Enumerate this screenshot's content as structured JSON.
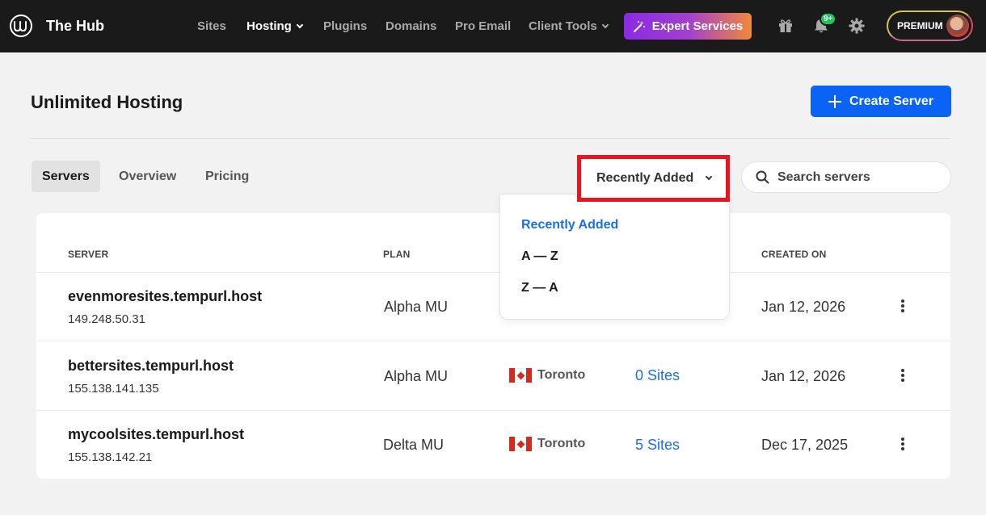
{
  "app": {
    "name": "The Hub"
  },
  "nav": {
    "items": [
      {
        "label": "Sites",
        "active": false,
        "has_menu": false
      },
      {
        "label": "Hosting",
        "active": true,
        "has_menu": true
      },
      {
        "label": "Plugins",
        "active": false,
        "has_menu": false
      },
      {
        "label": "Domains",
        "active": false,
        "has_menu": false
      },
      {
        "label": "Pro Email",
        "active": false,
        "has_menu": false
      },
      {
        "label": "Client Tools",
        "active": false,
        "has_menu": true
      }
    ],
    "expert_label": "Expert Services",
    "notifications_badge": "9+",
    "plan_label": "PREMIUM"
  },
  "page": {
    "title": "Unlimited Hosting",
    "create_label": "Create Server"
  },
  "tabs": [
    {
      "label": "Servers",
      "active": true
    },
    {
      "label": "Overview",
      "active": false
    },
    {
      "label": "Pricing",
      "active": false
    }
  ],
  "sort": {
    "selected": "Recently Added",
    "options": [
      "Recently Added",
      "A — Z",
      "Z — A"
    ]
  },
  "search": {
    "placeholder": "Search servers"
  },
  "table": {
    "headers": {
      "server": "SERVER",
      "plan": "PLAN",
      "created": "CREATED ON"
    },
    "rows": [
      {
        "name": "evenmoresites.tempurl.host",
        "ip": "149.248.50.31",
        "plan": "Alpha MU",
        "location": "",
        "sites": "",
        "created": "Jan 12, 2026"
      },
      {
        "name": "bettersites.tempurl.host",
        "ip": "155.138.141.135",
        "plan": "Alpha MU",
        "location": "Toronto",
        "sites": "0 Sites",
        "created": "Jan 12, 2026"
      },
      {
        "name": "mycoolsites.tempurl.host",
        "ip": "155.138.142.21",
        "plan": "Delta MU",
        "location": "Toronto",
        "sites": "5 Sites",
        "created": "Dec 17, 2025"
      }
    ]
  },
  "colors": {
    "accent": "#0b63f6",
    "link": "#1a6fe8",
    "highlight": "#e8141f",
    "nav_bg": "#1a1a1a",
    "badge": "#1fc45a"
  }
}
